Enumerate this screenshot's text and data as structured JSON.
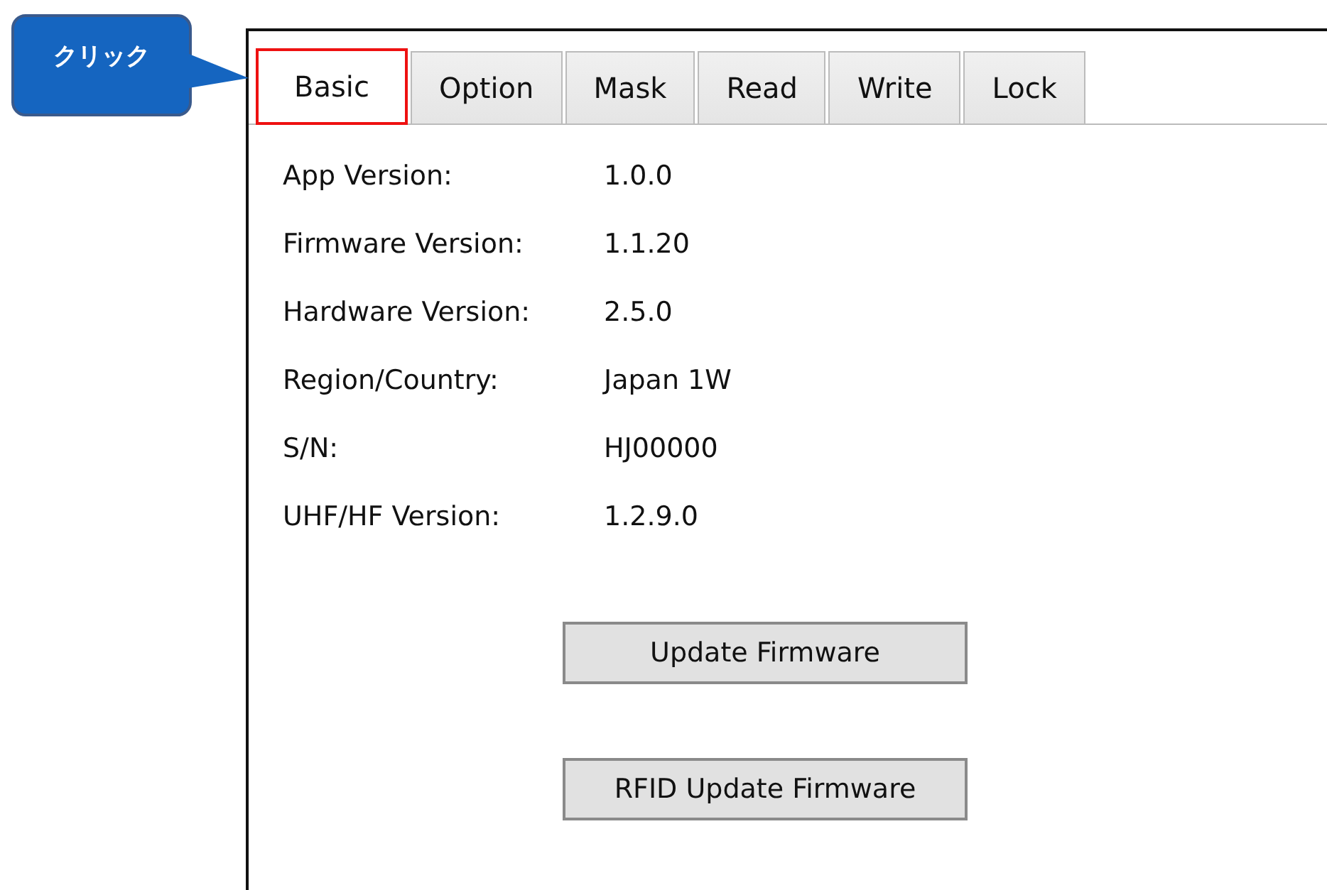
{
  "callout": {
    "text": "クリック"
  },
  "tabs": [
    {
      "label": "Basic",
      "selected": true,
      "highlighted": true
    },
    {
      "label": "Option",
      "selected": false,
      "highlighted": false
    },
    {
      "label": "Mask",
      "selected": false,
      "highlighted": false
    },
    {
      "label": "Read",
      "selected": false,
      "highlighted": false
    },
    {
      "label": "Write",
      "selected": false,
      "highlighted": false
    },
    {
      "label": "Lock",
      "selected": false,
      "highlighted": false
    }
  ],
  "info": [
    {
      "label": "App Version:",
      "value": "1.0.0"
    },
    {
      "label": "Firmware Version:",
      "value": "1.1.20"
    },
    {
      "label": "Hardware Version:",
      "value": "2.5.0"
    },
    {
      "label": "Region/Country:",
      "value": "Japan 1W"
    },
    {
      "label": "S/N:",
      "value": "HJ00000"
    },
    {
      "label": "UHF/HF Version:",
      "value": "1.2.9.0"
    }
  ],
  "buttons": [
    "Update Firmware",
    "RFID Update Firmware"
  ]
}
